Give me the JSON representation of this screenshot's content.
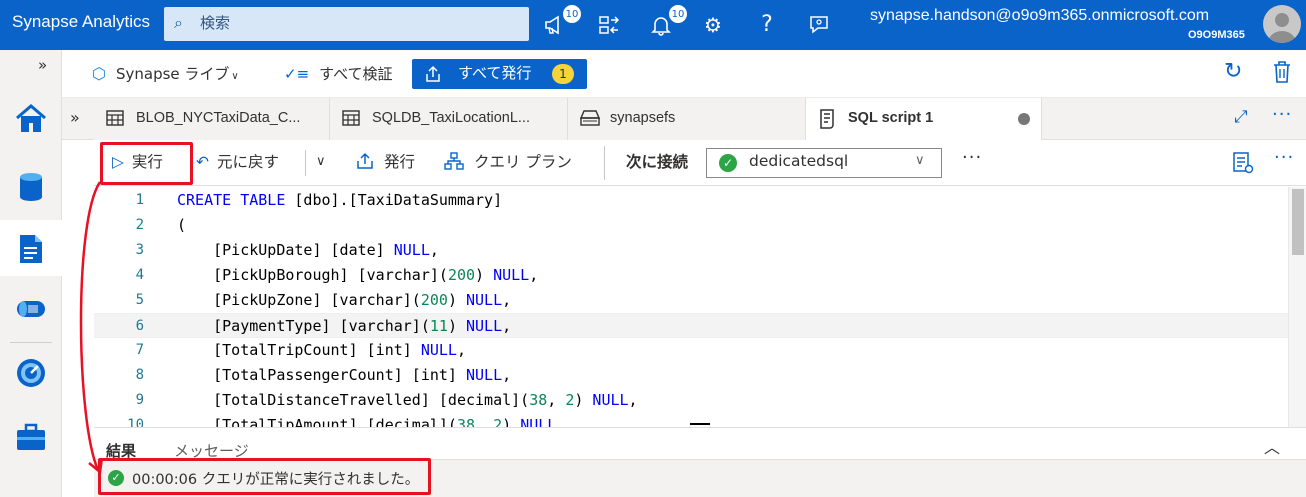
{
  "topbar": {
    "title": "Synapse Analytics",
    "search_placeholder": "検索",
    "notifications_badge_1": "10",
    "notifications_badge_2": "10",
    "user_email": "synapse.handson@o9o9m365.onmicrosoft.com",
    "user_org": "O9O9M365",
    "icons": [
      "megaphone-icon",
      "directory-switch-icon",
      "bell-icon",
      "gear-icon",
      "help-icon",
      "feedback-icon"
    ]
  },
  "main_toolbar": {
    "live_label": "Synapse ライブ",
    "validate_label": "すべて検証",
    "publish_label": "すべて発行",
    "publish_count": "1"
  },
  "tabs": [
    {
      "label": "BLOB_NYCTaxiData_C...",
      "icon": "table-icon"
    },
    {
      "label": "SQLDB_TaxiLocationL...",
      "icon": "table-icon"
    },
    {
      "label": "synapsefs",
      "icon": "storage-icon"
    },
    {
      "label": "SQL script 1",
      "icon": "script-icon",
      "active": true
    }
  ],
  "editor_toolbar": {
    "run_label": "実行",
    "undo_label": "元に戻す",
    "publish_label": "発行",
    "query_plan_label": "クエリ プラン",
    "connect_label": "次に接続",
    "connection_value": "dedicatedsql"
  },
  "code": {
    "lines": [
      {
        "n": "1",
        "parts": [
          [
            "kw",
            "CREATE TABLE"
          ],
          [
            "t",
            " [dbo].[TaxiDataSummary]"
          ]
        ]
      },
      {
        "n": "2",
        "parts": [
          [
            "t",
            "("
          ]
        ]
      },
      {
        "n": "3",
        "parts": [
          [
            "t",
            "    [PickUpDate] [date] "
          ],
          [
            "kw",
            "NULL"
          ],
          [
            "t",
            ","
          ]
        ]
      },
      {
        "n": "4",
        "parts": [
          [
            "t",
            "    [PickUpBorough] [varchar]("
          ],
          [
            "num",
            "200"
          ],
          [
            "t",
            ") "
          ],
          [
            "kw",
            "NULL"
          ],
          [
            "t",
            ","
          ]
        ]
      },
      {
        "n": "5",
        "parts": [
          [
            "t",
            "    [PickUpZone] [varchar]("
          ],
          [
            "num",
            "200"
          ],
          [
            "t",
            ") "
          ],
          [
            "kw",
            "NULL"
          ],
          [
            "t",
            ","
          ]
        ]
      },
      {
        "n": "6",
        "parts": [
          [
            "t",
            "    [PaymentType] [varchar]("
          ],
          [
            "num",
            "11"
          ],
          [
            "t",
            ") "
          ],
          [
            "kw",
            "NULL"
          ],
          [
            "t",
            ","
          ]
        ]
      },
      {
        "n": "7",
        "parts": [
          [
            "t",
            "    [TotalTripCount] [int] "
          ],
          [
            "kw",
            "NULL"
          ],
          [
            "t",
            ","
          ]
        ]
      },
      {
        "n": "8",
        "parts": [
          [
            "t",
            "    [TotalPassengerCount] [int] "
          ],
          [
            "kw",
            "NULL"
          ],
          [
            "t",
            ","
          ]
        ]
      },
      {
        "n": "9",
        "parts": [
          [
            "t",
            "    [TotalDistanceTravelled] [decimal]("
          ],
          [
            "num",
            "38"
          ],
          [
            "t",
            ", "
          ],
          [
            "num",
            "2"
          ],
          [
            "t",
            ") "
          ],
          [
            "kw",
            "NULL"
          ],
          [
            "t",
            ","
          ]
        ]
      },
      {
        "n": "10",
        "parts": [
          [
            "t",
            "    [TotalTipAmount] [decimal]("
          ],
          [
            "num",
            "38"
          ],
          [
            "t",
            ", "
          ],
          [
            "num",
            "2"
          ],
          [
            "t",
            ") "
          ],
          [
            "kw",
            "NULL"
          ],
          [
            "t",
            ","
          ]
        ]
      }
    ]
  },
  "results": {
    "tab_results": "結果",
    "tab_messages": "メッセージ",
    "status_text": "00:00:06 クエリが正常に実行されました。"
  },
  "colors": {
    "accent": "#0a63c9",
    "highlight": "#e81123",
    "success": "#2ba546"
  }
}
